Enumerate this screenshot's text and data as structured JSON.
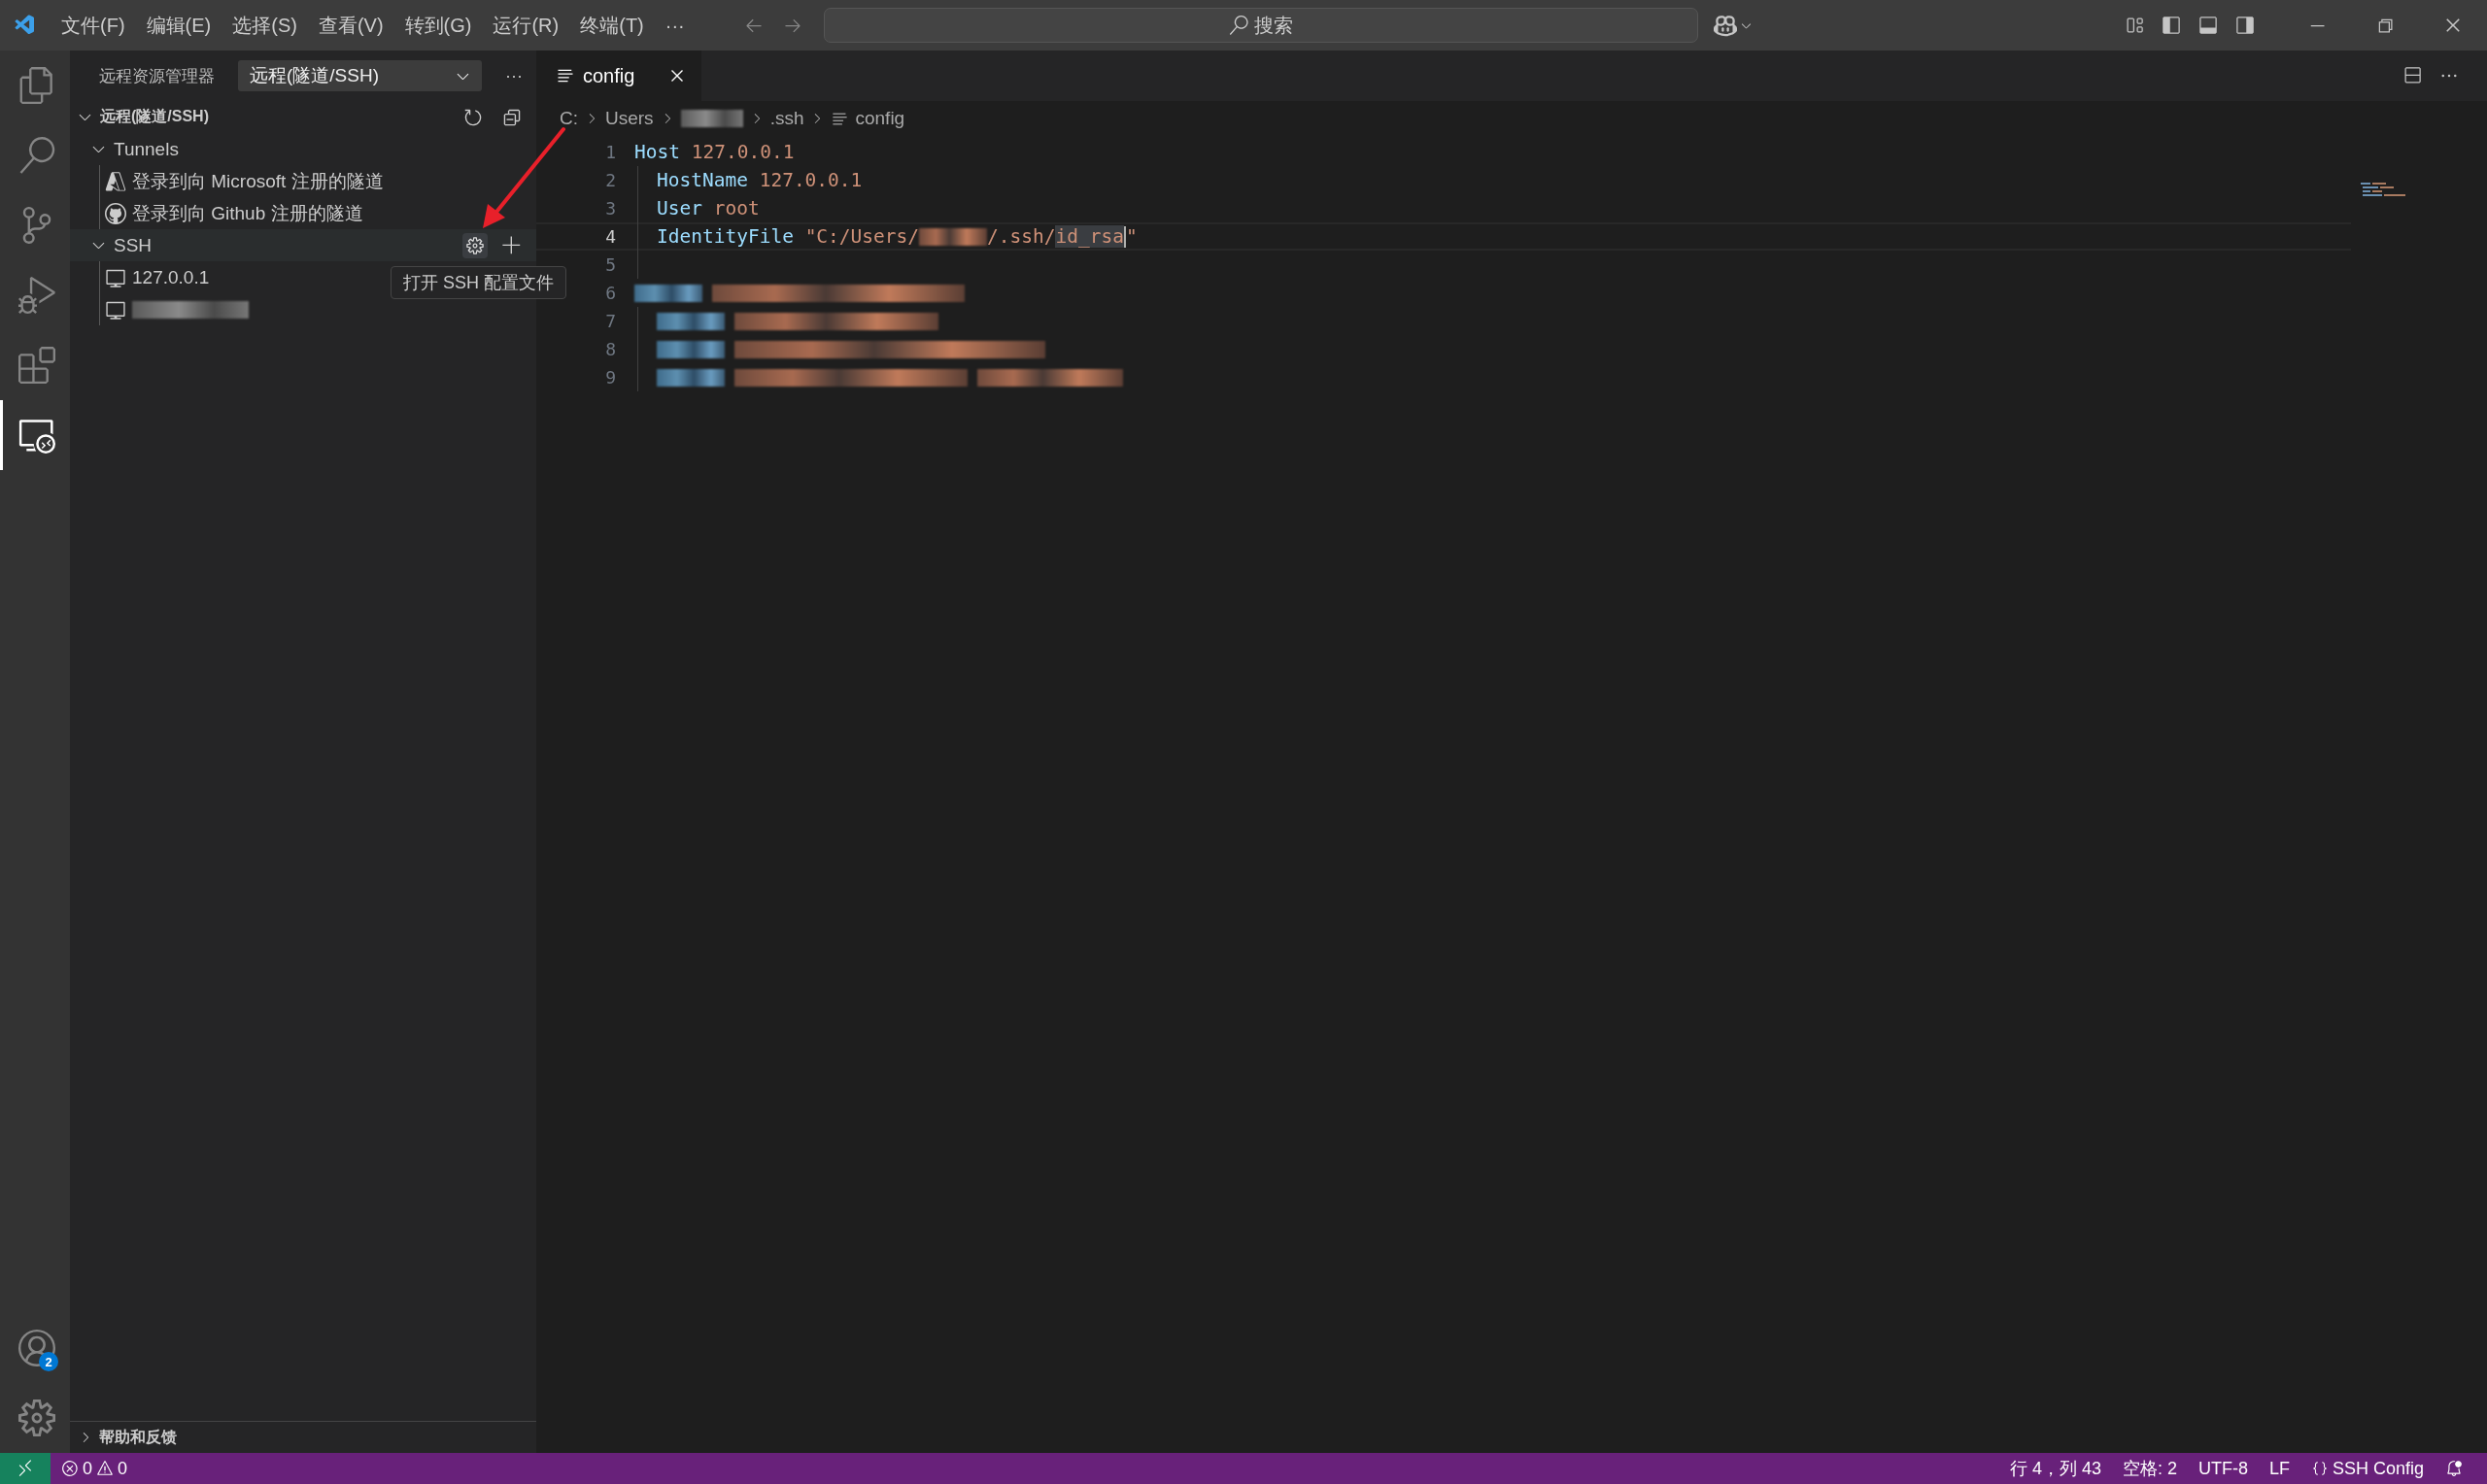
{
  "title_bar": {
    "menu": [
      {
        "label": "文件(F)"
      },
      {
        "label": "编辑(E)"
      },
      {
        "label": "选择(S)"
      },
      {
        "label": "查看(V)"
      },
      {
        "label": "转到(G)"
      },
      {
        "label": "运行(R)"
      },
      {
        "label": "终端(T)"
      }
    ],
    "more": "···",
    "search": {
      "placeholder": "搜索"
    }
  },
  "activity_bar": {
    "items": [
      {
        "kind": "explorer",
        "selected": false
      },
      {
        "kind": "search",
        "selected": false
      },
      {
        "kind": "source_control",
        "selected": false
      },
      {
        "kind": "run_debug",
        "selected": false
      },
      {
        "kind": "extensions",
        "selected": false
      },
      {
        "kind": "remote",
        "selected": true
      }
    ],
    "accounts_badge": "2"
  },
  "sidebar": {
    "title": "远程资源管理器",
    "view_select": {
      "value": "远程(隧道/SSH)"
    },
    "more": "···",
    "section": {
      "title": "远程(隧道/SSH)",
      "expanded": true
    },
    "tree": [
      {
        "label": "Tunnels",
        "expanded": true,
        "hovered": false,
        "children": [
          {
            "label": "登录到向 Microsoft 注册的隧道",
            "kind": "azure"
          },
          {
            "label": "登录到向 Github 注册的隧道",
            "kind": "github"
          }
        ]
      },
      {
        "label": "SSH",
        "expanded": true,
        "hovered": true,
        "children": [
          {
            "label": "127.0.0.1",
            "kind": "host"
          },
          {
            "kind": "redacted_host"
          }
        ]
      }
    ],
    "tooltip": "打开 SSH 配置文件",
    "help_section": {
      "title": "帮助和反馈",
      "expanded": false
    }
  },
  "editor": {
    "tabs": [
      {
        "label": "config",
        "selected": true
      }
    ],
    "breadcrumb": [
      {
        "kind": "text",
        "label": "C:"
      },
      {
        "kind": "text",
        "label": "Users"
      },
      {
        "kind": "redacted"
      },
      {
        "kind": "text",
        "label": ".ssh"
      },
      {
        "kind": "file",
        "label": "config"
      }
    ],
    "lines": [
      {
        "number": "1",
        "active": false,
        "indented": false,
        "tokens": [
          {
            "kind": "keyword",
            "text": "Host"
          },
          {
            "kind": "value",
            "text": " 127.0.0.1"
          }
        ]
      },
      {
        "number": "2",
        "active": false,
        "indented": true,
        "tokens": [
          {
            "kind": "keyword",
            "text": "HostName"
          },
          {
            "kind": "value",
            "text": " 127.0.0.1"
          }
        ]
      },
      {
        "number": "3",
        "active": false,
        "indented": true,
        "tokens": [
          {
            "kind": "keyword",
            "text": "User"
          },
          {
            "kind": "value",
            "text": " root"
          }
        ]
      },
      {
        "number": "4",
        "active": true,
        "indented": true,
        "tokens": [
          {
            "kind": "keyword",
            "text": "IdentityFile"
          },
          {
            "kind": "value",
            "text": " \"C:/Users/"
          },
          {
            "kind": "redacted_value"
          },
          {
            "kind": "value",
            "text": "/.ssh/"
          },
          {
            "kind": "selection",
            "text": "id_rsa",
            "caret": true
          },
          {
            "kind": "value",
            "text": "\""
          }
        ]
      },
      {
        "number": "5",
        "active": false,
        "indented": true
      },
      {
        "number": "6",
        "active": false,
        "indented": false,
        "tokens": [
          {
            "kind": "redacted_key"
          },
          {
            "kind": "redacted_value"
          }
        ]
      },
      {
        "number": "7",
        "active": false,
        "indented": true,
        "tokens": [
          {
            "kind": "redacted_key"
          },
          {
            "kind": "redacted_value"
          }
        ]
      },
      {
        "number": "8",
        "active": false,
        "indented": true,
        "tokens": [
          {
            "kind": "redacted_key"
          },
          {
            "kind": "redacted_value"
          }
        ]
      },
      {
        "number": "9",
        "active": false,
        "indented": true,
        "tokens": [
          {
            "kind": "redacted_key"
          },
          {
            "kind": "redacted_value"
          },
          {
            "kind": "redacted_value"
          }
        ]
      }
    ]
  },
  "status_bar": {
    "errors": "0",
    "warnings": "0",
    "position": "行 4，列 43",
    "indent": "空格: 2",
    "encoding": "UTF-8",
    "eol": "LF",
    "language": "SSH Config"
  }
}
